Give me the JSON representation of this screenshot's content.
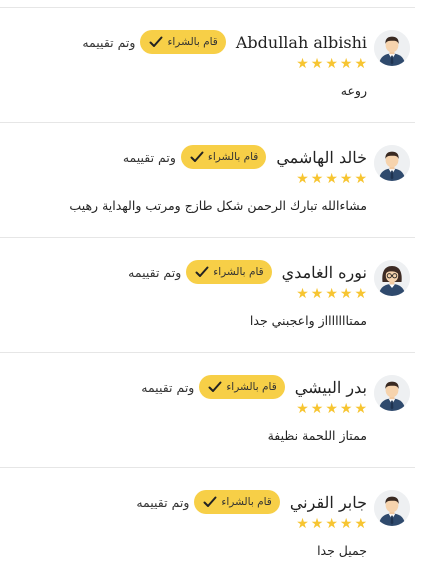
{
  "colors": {
    "badge_bg": "#f7cf47",
    "star": "#f7c531",
    "divider": "#e6e6e6"
  },
  "reviews": [
    {
      "name": "Abdullah albishi",
      "badge": "قام بالشراء",
      "rated": "وتم تقييمه",
      "rating": 5,
      "comment": "روعه",
      "avatar": "male-avatar-icon"
    },
    {
      "name": "خالد الهاشمي",
      "badge": "قام بالشراء",
      "rated": "وتم تقييمه",
      "rating": 5,
      "comment": "مشاءالله تبارك الرحمن شكل طازج ومرتب والهداية رهيب",
      "avatar": "male-avatar-icon"
    },
    {
      "name": "نوره الغامدي",
      "badge": "قام بالشراء",
      "rated": "وتم تقييمه",
      "rating": 5,
      "comment": "ممتاااااااز واعجبني جدا",
      "avatar": "female-avatar-icon"
    },
    {
      "name": "بدر البيشي",
      "badge": "قام بالشراء",
      "rated": "وتم تقييمه",
      "rating": 5,
      "comment": "ممتاز اللحمة نظيفة",
      "avatar": "male-avatar-icon"
    },
    {
      "name": "جابر القرني",
      "badge": "قام بالشراء",
      "rated": "وتم تقييمه",
      "rating": 5,
      "comment": "جميل جدا",
      "avatar": "male-avatar-icon"
    }
  ]
}
